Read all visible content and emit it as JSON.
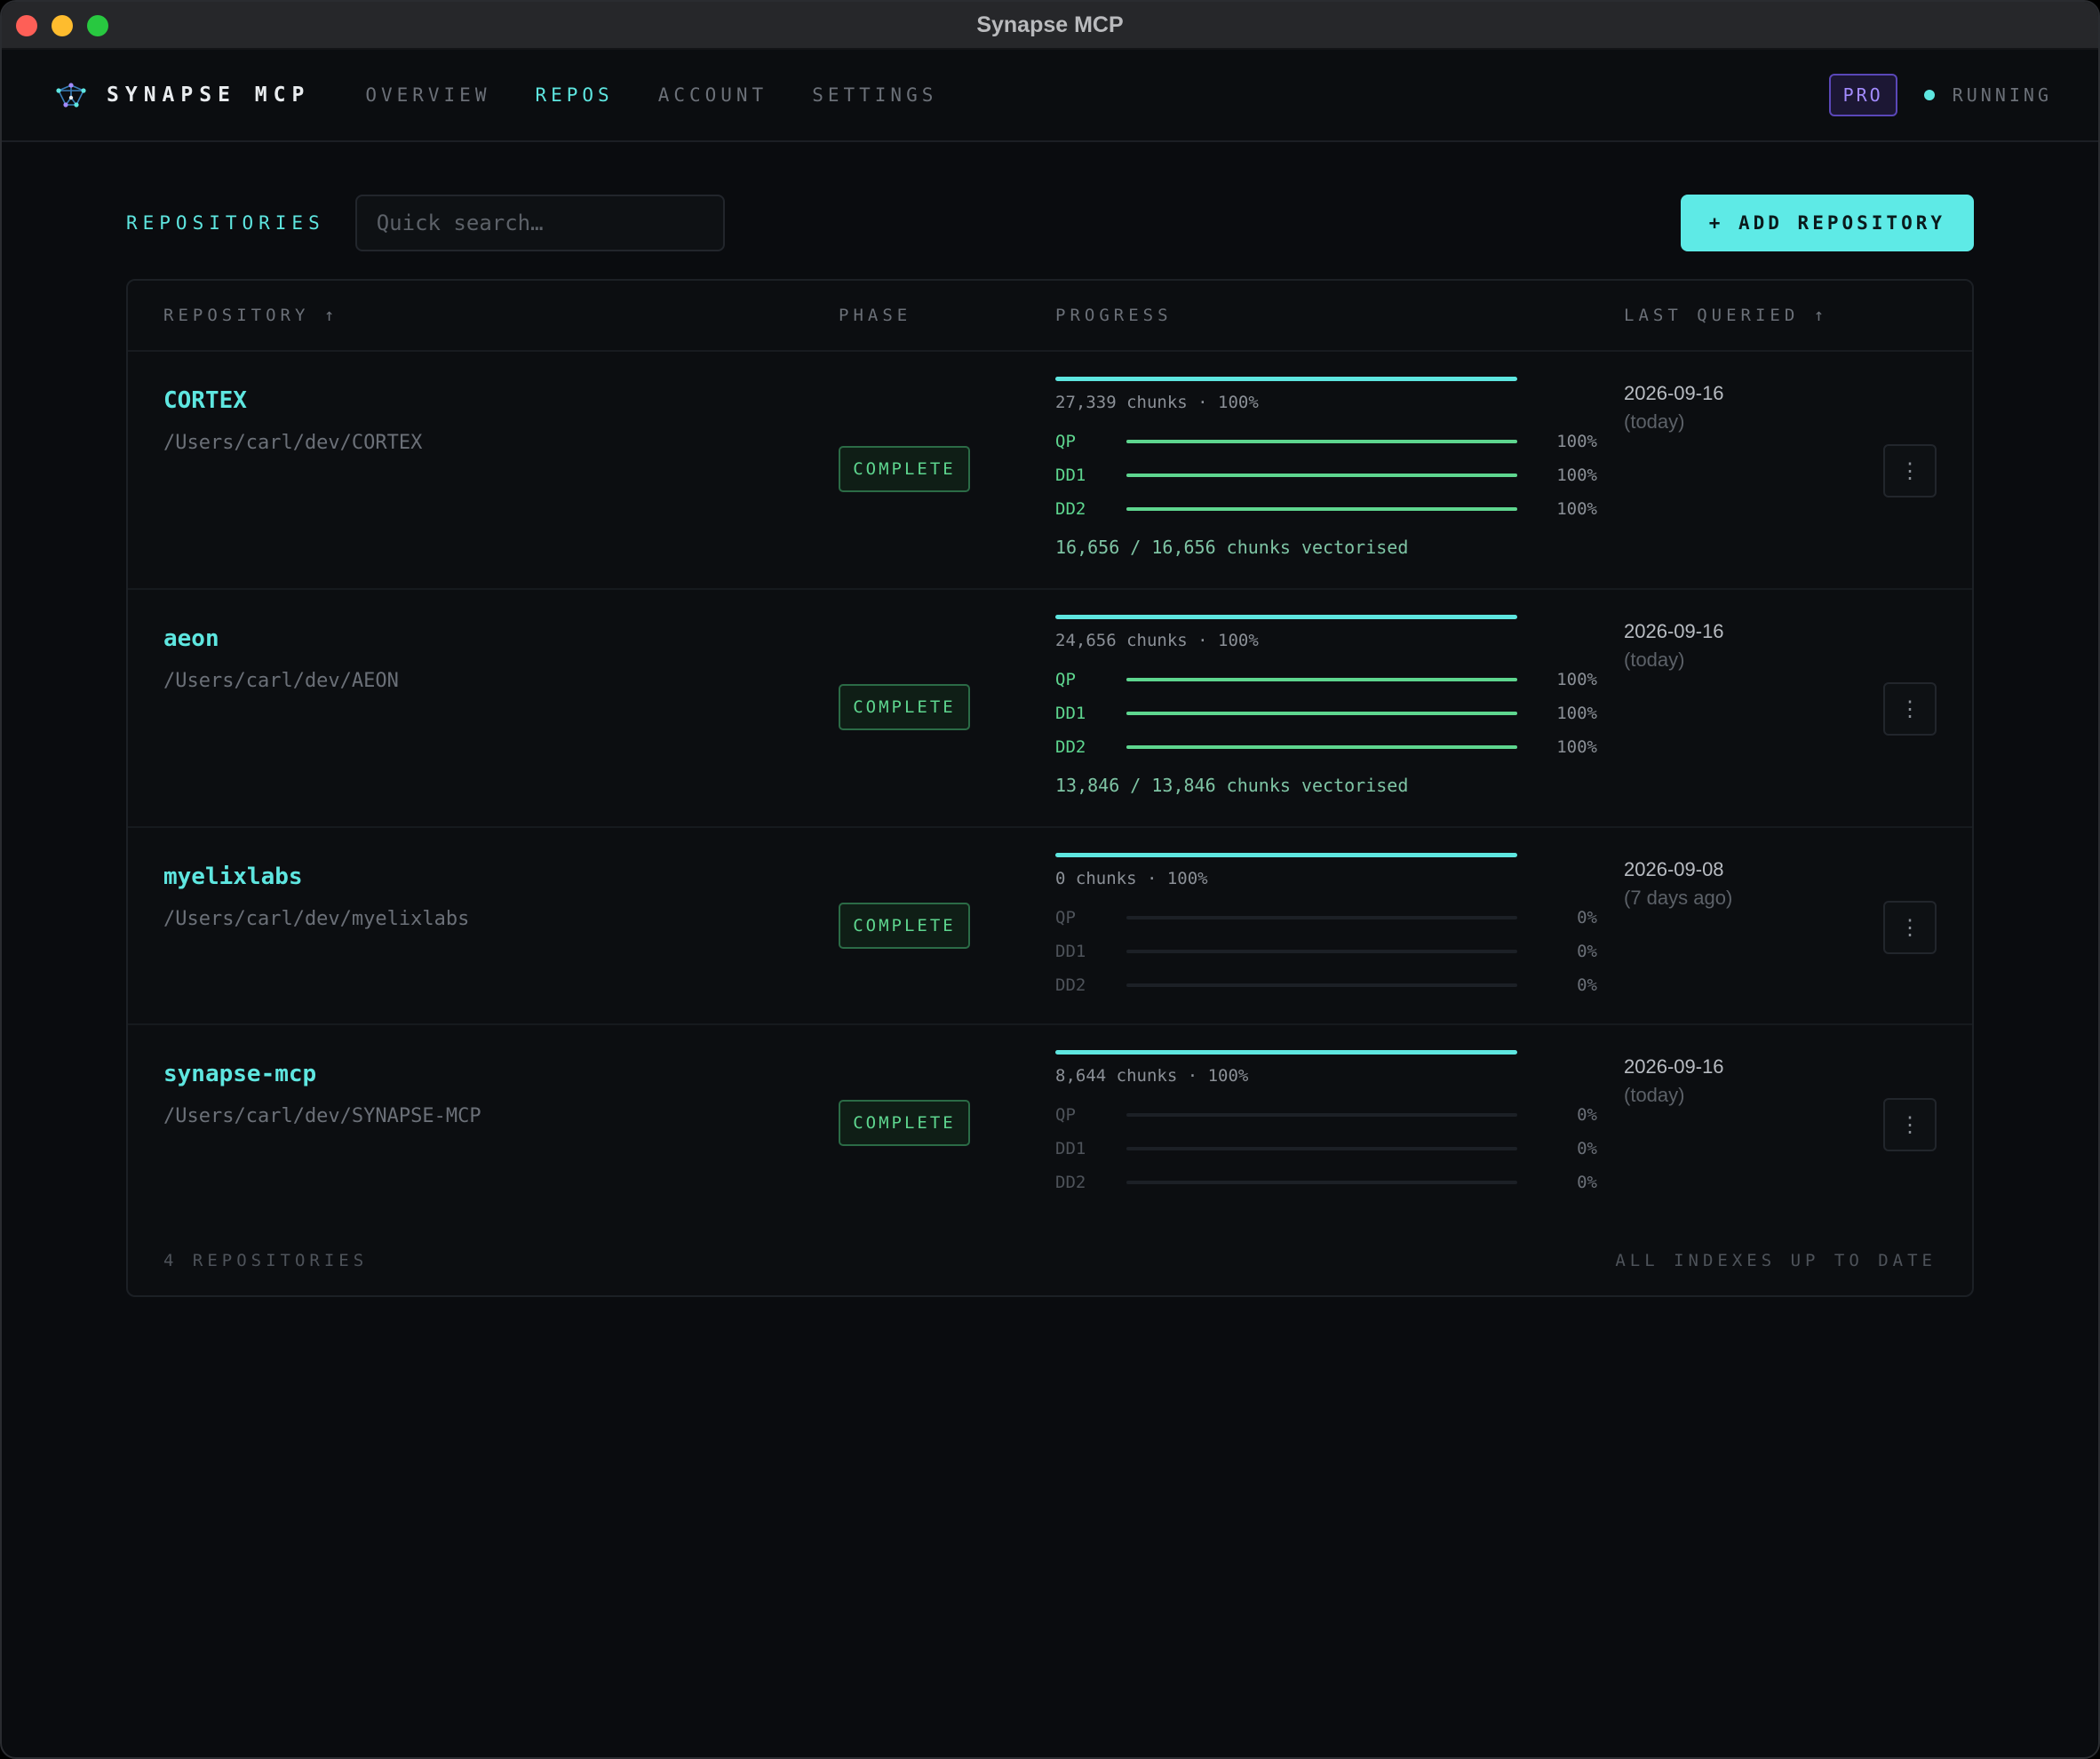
{
  "window": {
    "title": "Synapse MCP"
  },
  "nav": {
    "brand": "SYNAPSE MCP",
    "links": [
      "OVERVIEW",
      "REPOS",
      "ACCOUNT",
      "SETTINGS"
    ],
    "active": "REPOS",
    "plan_badge": "PRO",
    "status": "RUNNING"
  },
  "toolbar": {
    "title": "REPOSITORIES",
    "search_placeholder": "Quick search…",
    "add_button": "+ ADD REPOSITORY"
  },
  "table": {
    "headers": {
      "repository": "REPOSITORY ↑",
      "phase": "PHASE",
      "progress": "PROGRESS",
      "last_queried": "LAST QUERIED ↑"
    },
    "rows": [
      {
        "name": "CORTEX",
        "path": "/Users/carl/dev/CORTEX",
        "phase": "COMPLETE",
        "progress": 1.0,
        "chunks": "27,339 chunks · 100%",
        "subs": [
          {
            "label": "QP",
            "value": 1.0,
            "pct": "100%"
          },
          {
            "label": "DD1",
            "value": 1.0,
            "pct": "100%"
          },
          {
            "label": "DD2",
            "value": 1.0,
            "pct": "100%"
          }
        ],
        "vectorised": "16,656 / 16,656 chunks vectorised",
        "date": "2026-09-16",
        "relative": "(today)",
        "menu": "⋮"
      },
      {
        "name": "aeon",
        "path": "/Users/carl/dev/AEON",
        "phase": "COMPLETE",
        "progress": 1.0,
        "chunks": "24,656 chunks · 100%",
        "subs": [
          {
            "label": "QP",
            "value": 1.0,
            "pct": "100%"
          },
          {
            "label": "DD1",
            "value": 1.0,
            "pct": "100%"
          },
          {
            "label": "DD2",
            "value": 1.0,
            "pct": "100%"
          }
        ],
        "vectorised": "13,846 / 13,846 chunks vectorised",
        "date": "2026-09-16",
        "relative": "(today)",
        "menu": "⋮"
      },
      {
        "name": "myelixlabs",
        "path": "/Users/carl/dev/myelixlabs",
        "phase": "COMPLETE",
        "progress": 1.0,
        "chunks": "0 chunks · 100%",
        "subs": [
          {
            "label": "QP",
            "value": 0,
            "pct": "0%"
          },
          {
            "label": "DD1",
            "value": 0,
            "pct": "0%"
          },
          {
            "label": "DD2",
            "value": 0,
            "pct": "0%"
          }
        ],
        "vectorised": "",
        "date": "2026-09-08",
        "relative": "(7 days ago)",
        "menu": "⋮"
      },
      {
        "name": "synapse-mcp",
        "path": "/Users/carl/dev/SYNAPSE-MCP",
        "phase": "COMPLETE",
        "progress": 1.0,
        "chunks": "8,644 chunks · 100%",
        "subs": [
          {
            "label": "QP",
            "value": 0,
            "pct": "0%"
          },
          {
            "label": "DD1",
            "value": 0,
            "pct": "0%"
          },
          {
            "label": "DD2",
            "value": 0,
            "pct": "0%"
          }
        ],
        "vectorised": "",
        "date": "2026-09-16",
        "relative": "(today)",
        "menu": "⋮"
      }
    ],
    "footer_left": "4 REPOSITORIES",
    "footer_right": "ALL INDEXES UP TO DATE"
  },
  "colors": {
    "accent": "#5ee6e0",
    "success": "#5ed68f",
    "pro": "#a38bff"
  }
}
